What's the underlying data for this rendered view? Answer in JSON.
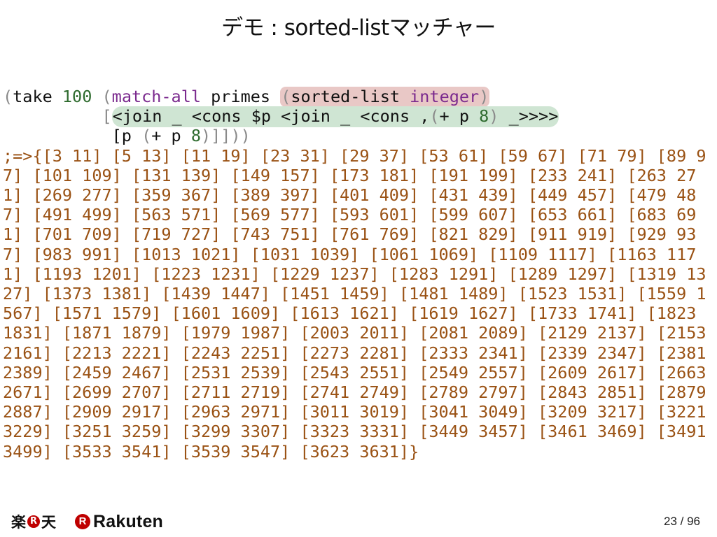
{
  "slide": {
    "title": "デモ : sorted-listマッチャー"
  },
  "code": {
    "line1": {
      "open": "(",
      "take": "take ",
      "n100": "100",
      "sp1": " ",
      "open2": "(",
      "match_all": "match-all",
      "primes": " primes ",
      "hl_open": "(",
      "sorted_list": "sorted-list ",
      "integer": "integer",
      "hl_close": ")"
    },
    "line2": {
      "indent": "          ",
      "bracket": "[",
      "pattern_a": "<join _ <cons $p <join _ <cons ,",
      "pattern_paren": "(",
      "pattern_plus": "+ p ",
      "pattern_8": "8",
      "pattern_close": ")",
      "pattern_tail": " _>>>>"
    },
    "line3": {
      "indent": "           ",
      "text_a": "[p ",
      "paren_open": "(",
      "text_b": "+ p ",
      "n8": "8",
      "closing": ")]]))"
    },
    "result": ";=>{[3 11] [5 13] [11 19] [23 31] [29 37] [53 61] [59 67] [71 79] [89 97] [101 109] [131 139] [149 157] [173 181] [191 199] [233 241] [263 271] [269 277] [359 367] [389 397] [401 409] [431 439] [449 457] [479 487] [491 499] [563 571] [569 577] [593 601] [599 607] [653 661] [683 691] [701 709] [719 727] [743 751] [761 769] [821 829] [911 919] [929 937] [983 991] [1013 1021] [1031 1039] [1061 1069] [1109 1117] [1163 1171] [1193 1201] [1223 1231] [1229 1237] [1283 1291] [1289 1297] [1319 1327] [1373 1381] [1439 1447] [1451 1459] [1481 1489] [1523 1531] [1559 1567] [1571 1579] [1601 1609] [1613 1621] [1619 1627] [1733 1741] [1823 1831] [1871 1879] [1979 1987] [2003 2011] [2081 2089] [2129 2137] [2153 2161] [2213 2221] [2243 2251] [2273 2281] [2333 2341] [2339 2347] [2381 2389] [2459 2467] [2531 2539] [2543 2551] [2549 2557] [2609 2617] [2663 2671] [2699 2707] [2711 2719] [2741 2749] [2789 2797] [2843 2851] [2879 2887] [2909 2917] [2963 2971] [3011 3019] [3041 3049] [3209 3217] [3221 3229] [3251 3259] [3299 3307] [3323 3331] [3449 3457] [3461 3469] [3491 3499] [3533 3541] [3539 3547] [3623 3631]}"
  },
  "footer": {
    "logo_jp_left": "楽",
    "logo_jp_r": "R",
    "logo_jp_right": "天",
    "logo_en_r": "R",
    "brand": "Rakuten",
    "page_current": "23",
    "page_sep": " / ",
    "page_total": "96"
  },
  "colors": {
    "paren": "#8a8a8a",
    "number": "#2e6b2e",
    "keyword": "#7b2a8e",
    "result": "#9a5214",
    "highlight_red": "#e9c8c6",
    "highlight_green": "#cfe5d3",
    "brand_red": "#bf0000"
  }
}
